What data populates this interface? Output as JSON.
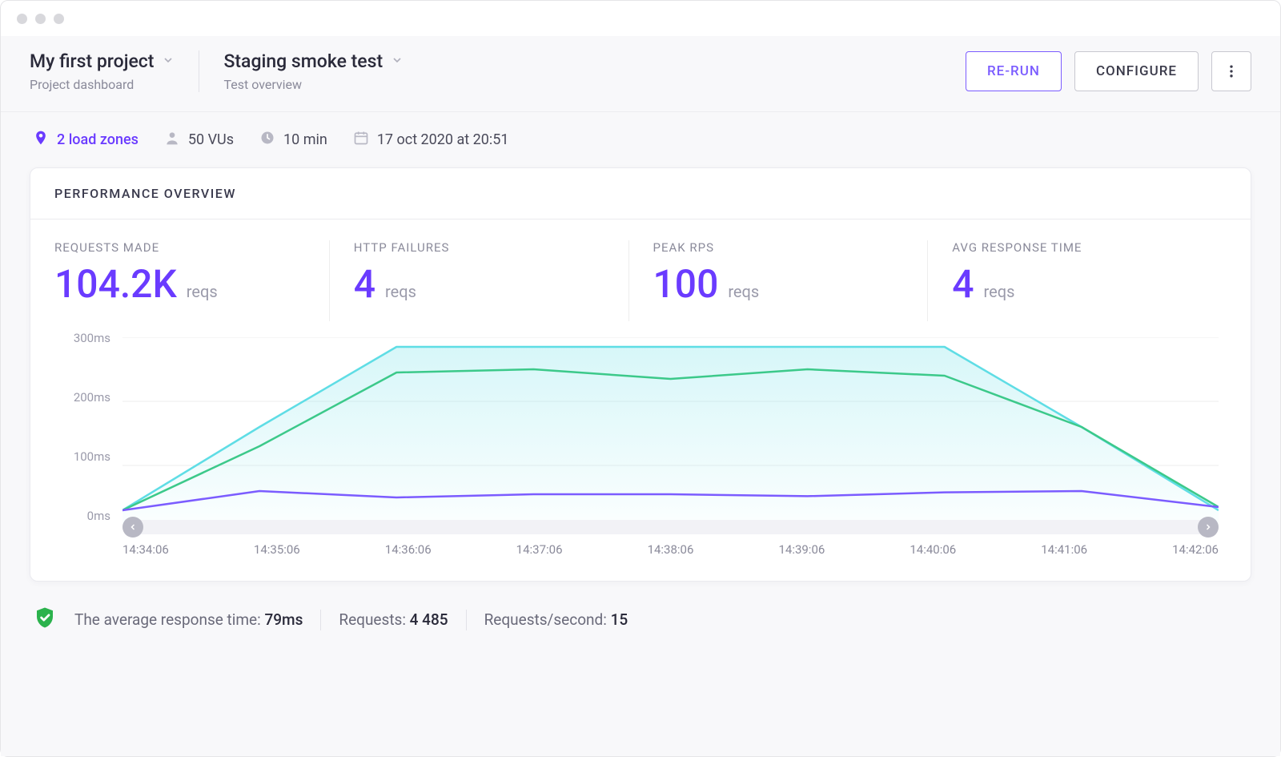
{
  "header": {
    "project_title": "My first project",
    "project_sub": "Project dashboard",
    "test_title": "Staging smoke test",
    "test_sub": "Test overview",
    "rerun_label": "RE-RUN",
    "configure_label": "CONFIGURE"
  },
  "meta": {
    "load_zones": "2 load zones",
    "vus": "50 VUs",
    "duration": "10 min",
    "datetime": "17 oct 2020 at 20:51"
  },
  "card": {
    "title": "PERFORMANCE OVERVIEW"
  },
  "metrics": [
    {
      "label": "REQUESTS MADE",
      "value": "104.2K",
      "unit": "reqs"
    },
    {
      "label": "HTTP FAILURES",
      "value": "4",
      "unit": "reqs"
    },
    {
      "label": "PEAK RPS",
      "value": "100",
      "unit": "reqs"
    },
    {
      "label": "AVG RESPONSE TIME",
      "value": "4",
      "unit": "reqs"
    }
  ],
  "footer": {
    "avg_label": "The average response time:",
    "avg_value": "79ms",
    "req_label": "Requests:",
    "req_value": "4 485",
    "rps_label": "Requests/second:",
    "rps_value": "15"
  },
  "chart_data": {
    "type": "line",
    "ylabel": "ms",
    "ylim": [
      0,
      300
    ],
    "y_ticks": [
      "300ms",
      "200ms",
      "100ms",
      "0ms"
    ],
    "x": [
      "14:34:06",
      "14:35:06",
      "14:36:06",
      "14:37:06",
      "14:38:06",
      "14:39:06",
      "14:40:06",
      "14:41:06",
      "14:42:06"
    ],
    "series": [
      {
        "name": "vus_area",
        "color": "#5fdde5",
        "fill": true,
        "values": [
          30,
          160,
          285,
          285,
          285,
          285,
          285,
          160,
          30
        ]
      },
      {
        "name": "rps",
        "color": "#3cc98a",
        "values": [
          30,
          130,
          245,
          250,
          235,
          250,
          240,
          160,
          35
        ]
      },
      {
        "name": "response_time",
        "color": "#7b5cff",
        "values": [
          30,
          60,
          50,
          55,
          55,
          52,
          58,
          60,
          35
        ]
      }
    ]
  }
}
